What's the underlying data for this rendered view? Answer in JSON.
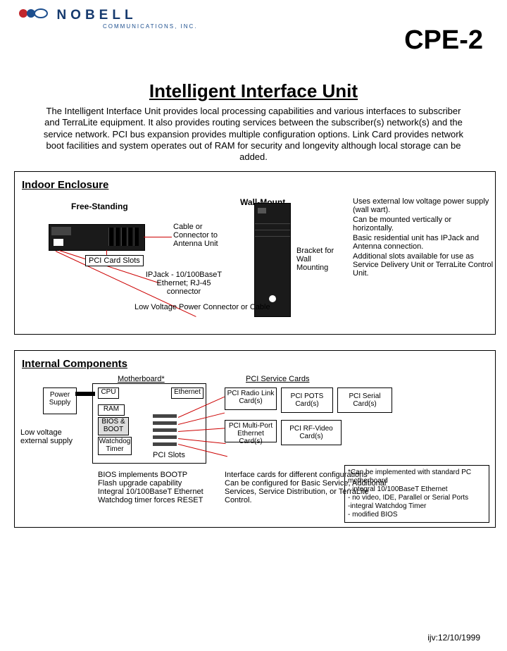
{
  "header": {
    "brand": "NOBELL",
    "brand_sub": "COMMUNICATIONS, INC.",
    "code": "CPE-2",
    "title": "Intelligent Interface Unit",
    "intro": "The Intelligent Interface Unit provides local processing capabilities and various interfaces to subscriber and TerraLite equipment. It also provides routing services between the subscriber(s) network(s) and the service network. PCI bus expansion provides multiple configuration options. Link Card provides network boot facilities and system operates out of RAM for security and longevity although local storage can be added."
  },
  "indoor": {
    "heading": "Indoor Enclosure",
    "free_label": "Free-Standing",
    "wall_label": "Wall-Mount",
    "pci_slots": "PCI Card Slots",
    "cable_conn": "Cable or Connector to Antenna Unit",
    "ipjack": "IPJack - 10/100BaseT Ethernet; RJ-45 connector",
    "lvp": "Low Voltage Power Connector or Cable",
    "bracket": "Bracket for Wall Mounting",
    "notes": [
      "Uses external low voltage power supply (wall wart).",
      "Can be mounted vertically or horizontally.",
      "Basic residential unit has IPJack and Antenna connection.",
      "Additional slots available for use as Service Delivery Unit or TerraLite Control Unit."
    ]
  },
  "internal": {
    "heading": "Internal Components",
    "mb_label": "Motherboard*",
    "svc_label": "PCI Service Cards",
    "power": "Power Supply",
    "power_note": "Low voltage external supply",
    "cpu": "CPU",
    "ram": "RAM",
    "bios": "BIOS & BOOT",
    "wd": "Watchdog Timer",
    "eth": "Ethernet",
    "pcislots": "PCI Slots",
    "bios_notes": "BIOS implements BOOTP\nFlash upgrade capability\nIntegral 10/100BaseT Ethernet\nWatchdog timer forces RESET",
    "cards": {
      "radio": "PCI Radio Link Card(s)",
      "pots": "PCI POTS Card(s)",
      "serial": "PCI Serial Card(s)",
      "multi": "PCI Multi-Port Ethernet Card(s)",
      "rfv": "PCI RF-Video Card(s)"
    },
    "svc_notes": "Interface cards for different configurations\nCan be configured for Basic Service, Additional Services, Service Distribution, or TerraLite Control.",
    "star_note": "*Can be implemented with standard PC motherboard\n - integral 10/100BaseT Ethernet\n - no video, IDE, Parallel or Serial Ports\n -integral Watchdog Timer\n - modified BIOS"
  },
  "footer": "ijv:12/10/1999"
}
